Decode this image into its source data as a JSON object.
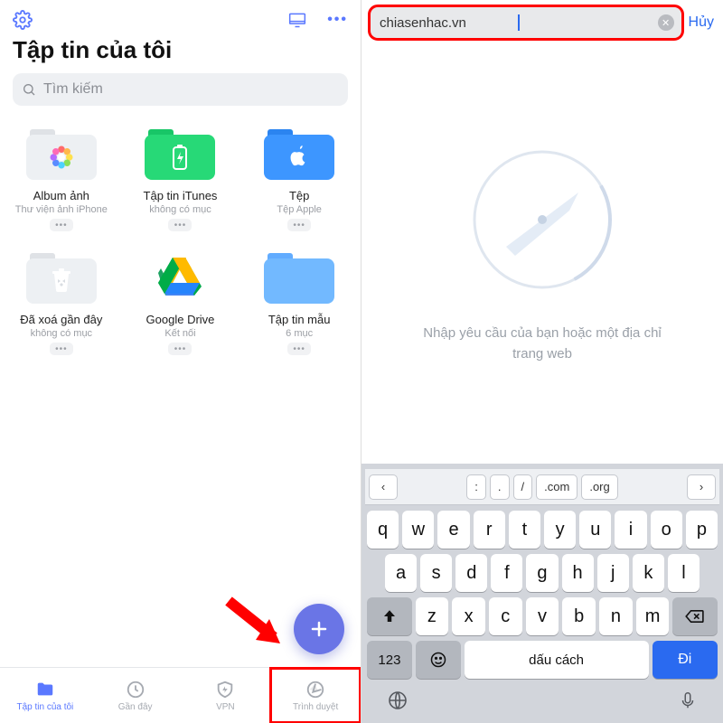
{
  "left": {
    "title": "Tập tin của tôi",
    "search_placeholder": "Tìm kiếm",
    "items": [
      {
        "name": "Album ảnh",
        "sub": "Thư viện ảnh iPhone"
      },
      {
        "name": "Tập tin iTunes",
        "sub": "không có mục"
      },
      {
        "name": "Tệp",
        "sub": "Tệp Apple"
      },
      {
        "name": "Đã xoá gần đây",
        "sub": "không có mục"
      },
      {
        "name": "Google Drive",
        "sub": "Kết nối"
      },
      {
        "name": "Tập tin mẫu",
        "sub": "6 mục"
      }
    ],
    "tabs": [
      {
        "label": "Tập tin của tôi"
      },
      {
        "label": "Gần đây"
      },
      {
        "label": "VPN"
      },
      {
        "label": "Trình duyệt"
      }
    ]
  },
  "right": {
    "url": "chiasenhac.vn",
    "cancel": "Hủy",
    "prompt": "Nhập yêu cầu của bạn hoặc một địa chỉ trang web"
  },
  "keyboard": {
    "acc": {
      "colon": ":",
      "dot": ".",
      "slash": "/",
      "com": ".com",
      "org": ".org"
    },
    "row1": [
      "q",
      "w",
      "e",
      "r",
      "t",
      "y",
      "u",
      "i",
      "o",
      "p"
    ],
    "row2": [
      "a",
      "s",
      "d",
      "f",
      "g",
      "h",
      "j",
      "k",
      "l"
    ],
    "row3": [
      "z",
      "x",
      "c",
      "v",
      "b",
      "n",
      "m"
    ],
    "k123": "123",
    "space": "dấu cách",
    "go": "Đi"
  }
}
